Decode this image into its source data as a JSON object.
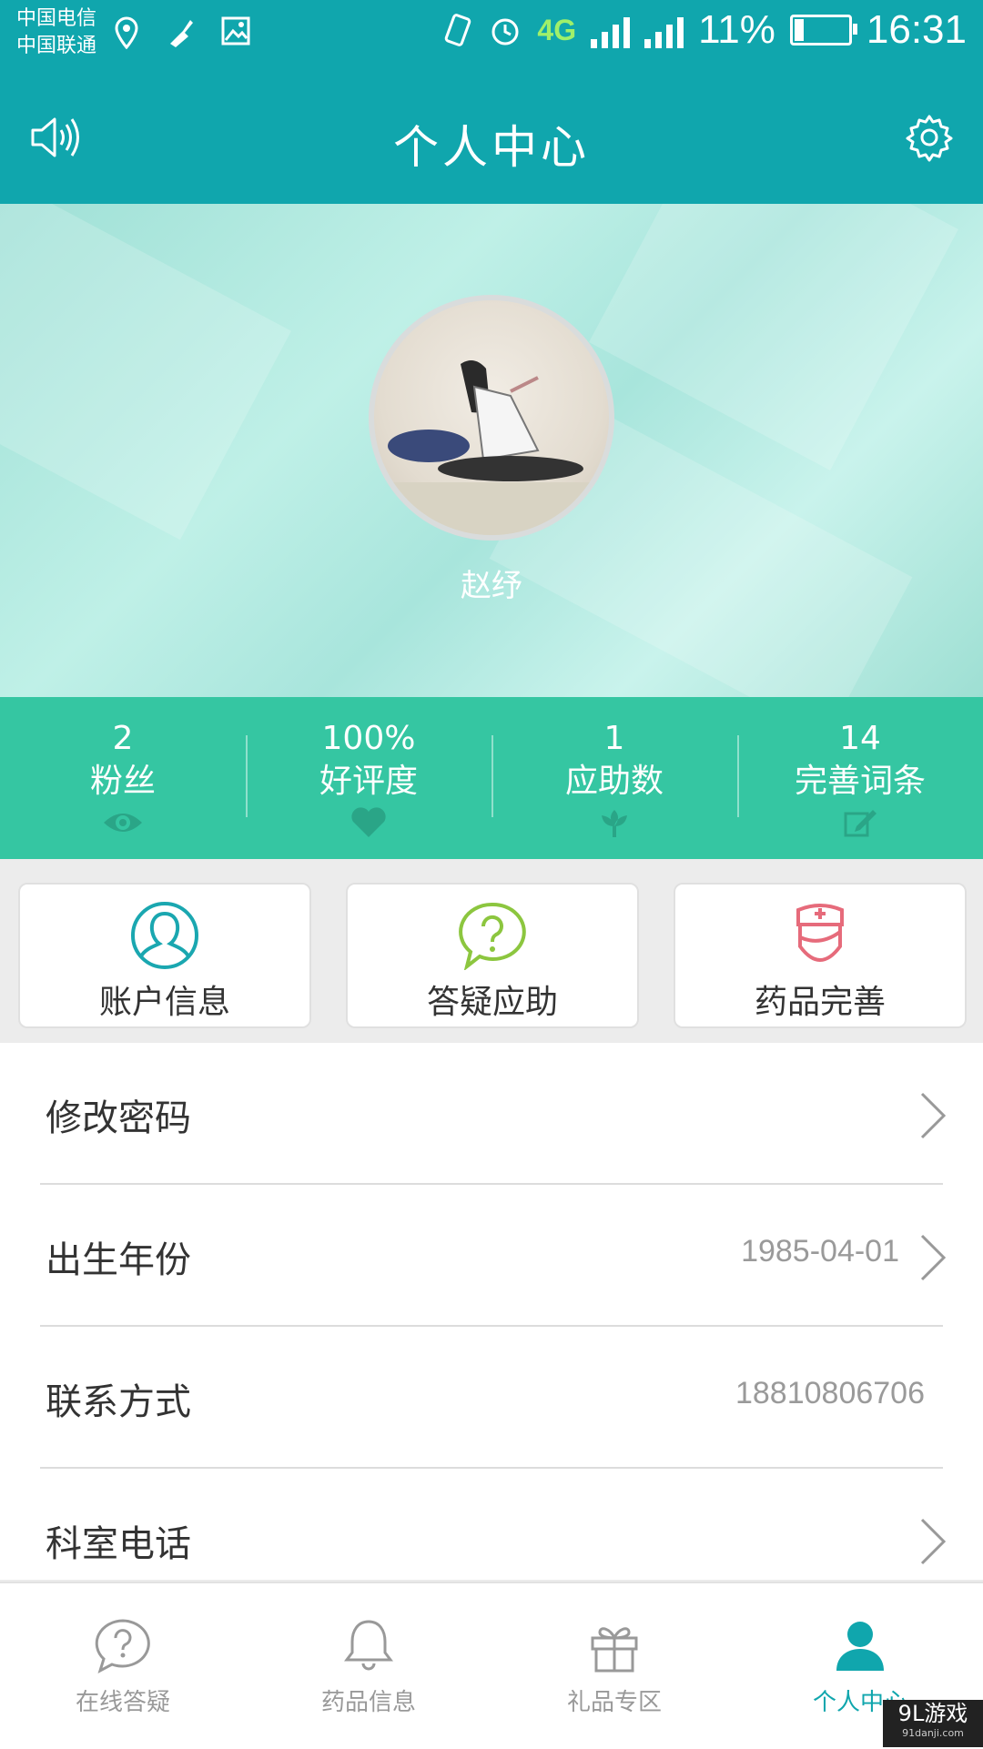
{
  "status_bar": {
    "carrier_1": "中国电信",
    "carrier_2": "中国联通",
    "network": "4G",
    "battery": "11%",
    "time": "16:31"
  },
  "header": {
    "title": "个人中心",
    "left_icon": "speaker-icon",
    "right_icon": "gear-icon"
  },
  "profile": {
    "name": "赵纾"
  },
  "stats": [
    {
      "value": "2",
      "label": "粉丝",
      "icon": "eye-icon"
    },
    {
      "value": "100%",
      "label": "好评度",
      "icon": "heart-icon"
    },
    {
      "value": "1",
      "label": "应助数",
      "icon": "flower-icon"
    },
    {
      "value": "14",
      "label": "完善词条",
      "icon": "edit-icon"
    }
  ],
  "cards": [
    {
      "label": "账户信息",
      "icon": "user-icon",
      "color": "#1aa7b0"
    },
    {
      "label": "答疑应助",
      "icon": "question-bubble-icon",
      "color": "#8cc63f"
    },
    {
      "label": "药品完善",
      "icon": "nurse-icon",
      "color": "#e66b7b"
    }
  ],
  "settings": [
    {
      "label": "修改密码",
      "value": ""
    },
    {
      "label": "出生年份",
      "value": "1985-04-01"
    },
    {
      "label": "联系方式",
      "value": "18810806706"
    },
    {
      "label": "科室电话",
      "value": ""
    }
  ],
  "tabs": [
    {
      "label": "在线答疑",
      "icon": "question-bubble-icon"
    },
    {
      "label": "药品信息",
      "icon": "bell-icon"
    },
    {
      "label": "礼品专区",
      "icon": "gift-icon"
    },
    {
      "label": "个人中心",
      "icon": "person-icon",
      "active": true
    }
  ],
  "watermark": {
    "brand": "9L游戏",
    "site": "91danji.com"
  },
  "colors": {
    "primary": "#10a6ad",
    "stats_bg": "#35c6a2"
  }
}
